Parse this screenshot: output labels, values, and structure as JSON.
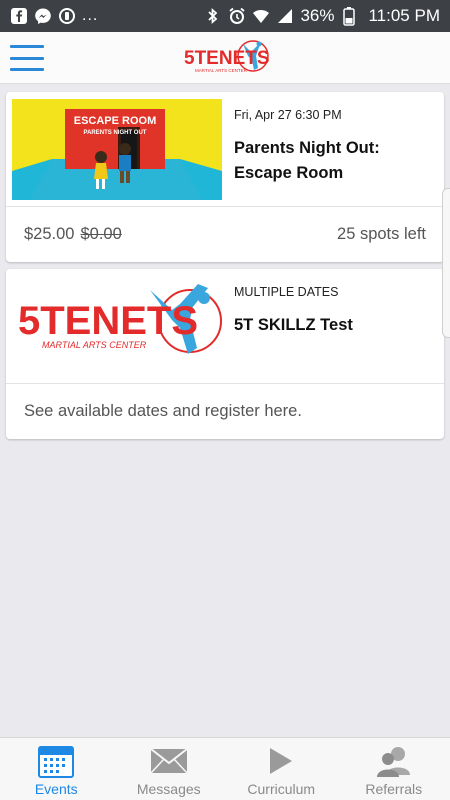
{
  "status_bar": {
    "overflow": "...",
    "battery": "36%",
    "time": "11:05 PM",
    "icons": [
      "facebook-icon",
      "messenger-icon",
      "sync-icon",
      "bluetooth-icon",
      "alarm-icon",
      "wifi-icon",
      "signal-icon",
      "battery-icon"
    ]
  },
  "header": {
    "menu_icon": "hamburger-icon",
    "logo_main": "5TENETS",
    "logo_sub": "MARTIAL ARTS CENTER"
  },
  "events": [
    {
      "image_text": [
        "ESCAPE ROOM",
        "PARENTS NIGHT OUT"
      ],
      "date": "Fri, Apr 27 6:30 PM",
      "title": "Parents Night Out: Escape Room",
      "price": "$25.00",
      "original_price": "$0.00",
      "spots": "25 spots left"
    },
    {
      "image_text": [
        "5TENETS",
        "MARTIAL ARTS CENTER"
      ],
      "date": "MULTIPLE DATES",
      "title": "5T SKILLZ Test",
      "footer": "See available dates and register here."
    }
  ],
  "nav": {
    "items": [
      {
        "label": "Events",
        "icon": "calendar-icon",
        "active": true
      },
      {
        "label": "Messages",
        "icon": "envelope-icon",
        "active": false
      },
      {
        "label": "Curriculum",
        "icon": "play-icon",
        "active": false
      },
      {
        "label": "Referrals",
        "icon": "people-icon",
        "active": false
      }
    ]
  },
  "colors": {
    "accent": "#1e88e5",
    "brand_red": "#e32b2b",
    "brand_blue": "#3aa6de"
  }
}
